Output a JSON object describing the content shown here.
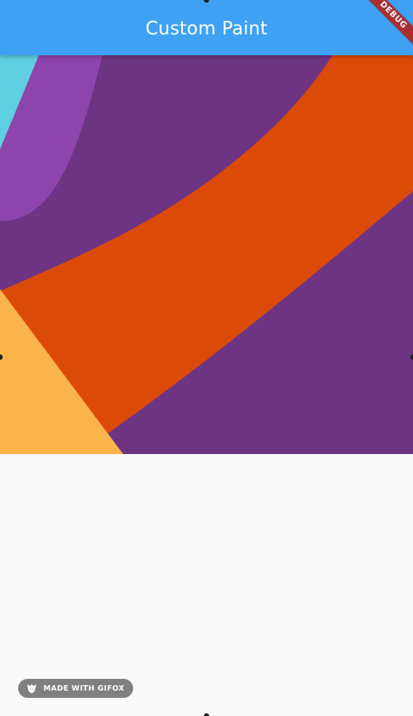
{
  "app_bar": {
    "title": "Custom Paint",
    "background_color": "#3ea1f3"
  },
  "debug_banner": {
    "label": "DEBUG",
    "color": "#b3261e"
  },
  "canvas": {
    "background_color": "#6c3483",
    "colors": {
      "cyan": "#5fcfe2",
      "purple": "#8e44ad",
      "orange": "#dc4a08",
      "yellow": "#fbb34b"
    }
  },
  "watermark": {
    "label": "MADE WITH GIFOX",
    "logo_icon": "fox-icon"
  }
}
